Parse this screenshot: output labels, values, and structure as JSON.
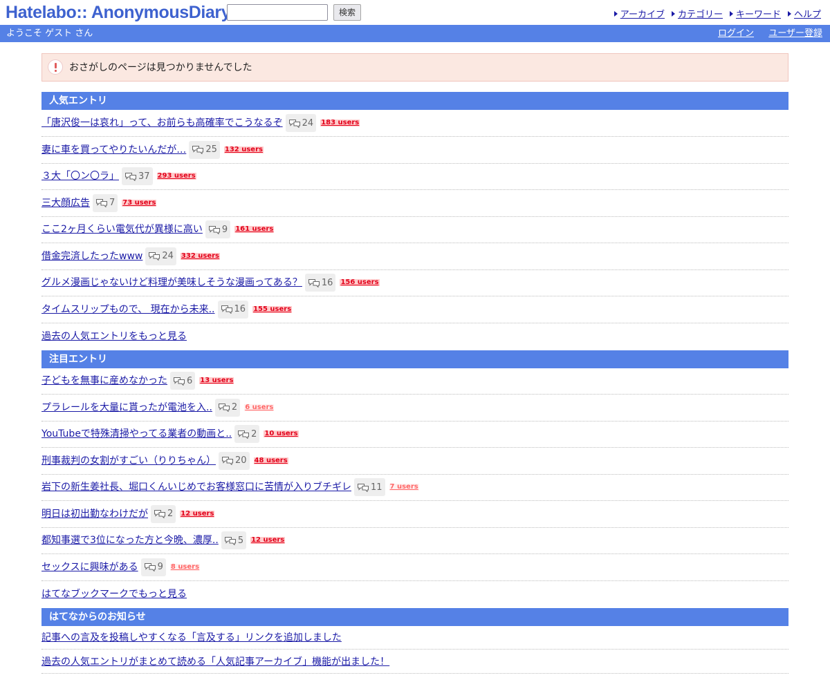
{
  "header": {
    "logo": "Hatelabo:: AnonymousDiary",
    "search_button": "検索",
    "search_value": "",
    "nav": [
      "アーカイブ",
      "カテゴリー",
      "キーワード",
      "ヘルプ"
    ]
  },
  "subheader": {
    "welcome": "ようこそ ゲスト さん",
    "login": "ログイン",
    "register": "ユーザー登録"
  },
  "notice": {
    "text": "おさがしのページは見つかりませんでした"
  },
  "popular": {
    "title": "人気エントリ",
    "entries": [
      {
        "title": "「唐沢俊一は哀れ」って、お前らも高確率でこうなるぞ",
        "comments": "24",
        "users": "183 users"
      },
      {
        "title": "妻に車を買ってやりたいんだが…",
        "comments": "25",
        "users": "132 users"
      },
      {
        "title": "３大「〇ン〇ラ」",
        "comments": "37",
        "users": "293 users"
      },
      {
        "title": "三大顔広告",
        "comments": "7",
        "users": "73 users"
      },
      {
        "title": "ここ2ヶ月くらい電気代が異様に高い",
        "comments": "9",
        "users": "161 users"
      },
      {
        "title": "借金完済したったwww",
        "comments": "24",
        "users": "332 users"
      },
      {
        "title": "グルメ漫画じゃないけど料理が美味しそうな漫画ってある？",
        "comments": "16",
        "users": "156 users"
      },
      {
        "title": "タイムスリップもので、 現在から未来..",
        "comments": "16",
        "users": "155 users"
      }
    ],
    "more": "過去の人気エントリをもっと見る"
  },
  "notable": {
    "title": "注目エントリ",
    "entries": [
      {
        "title": "子どもを無事に産めなかった",
        "comments": "6",
        "users": "13 users",
        "style": "hot"
      },
      {
        "title": "プラレールを大量に貰ったが電池を入..",
        "comments": "2",
        "users": "6 users",
        "style": "light"
      },
      {
        "title": "YouTubeで特殊清掃やってる業者の動画と..",
        "comments": "2",
        "users": "10 users",
        "style": "hot"
      },
      {
        "title": "刑事裁判の女割がすごい（りりちゃん）",
        "comments": "20",
        "users": "48 users",
        "style": "hot"
      },
      {
        "title": "岩下の新生姜社長、堀口くんいじめでお客様窓口に苦情が入りブチギレ",
        "comments": "11",
        "users": "7 users",
        "style": "light"
      },
      {
        "title": "明日は初出勤なわけだが",
        "comments": "2",
        "users": "12 users",
        "style": "hot"
      },
      {
        "title": "都知事選で3位になった方と今晩、濃厚..",
        "comments": "5",
        "users": "12 users",
        "style": "hot"
      },
      {
        "title": "セックスに興味がある",
        "comments": "9",
        "users": "8 users",
        "style": "light"
      }
    ],
    "more": "はてなブックマークでもっと見る"
  },
  "news": {
    "title": "はてなからのお知らせ",
    "items": [
      "記事への言及を投稿しやすくなる「言及する」リンクを追加しました",
      "過去の人気エントリがまとめて読める「人気記事アーカイブ」機能が出ました！"
    ]
  },
  "colors": {
    "brand": "#3e62cf",
    "bar": "#5581e6",
    "link": "#1a1aa6",
    "users": "#e2001a"
  },
  "icons": {
    "comment": "speech-bubble-icon",
    "notice": "exclamation-icon",
    "nav": "triangle-arrow-icon"
  }
}
